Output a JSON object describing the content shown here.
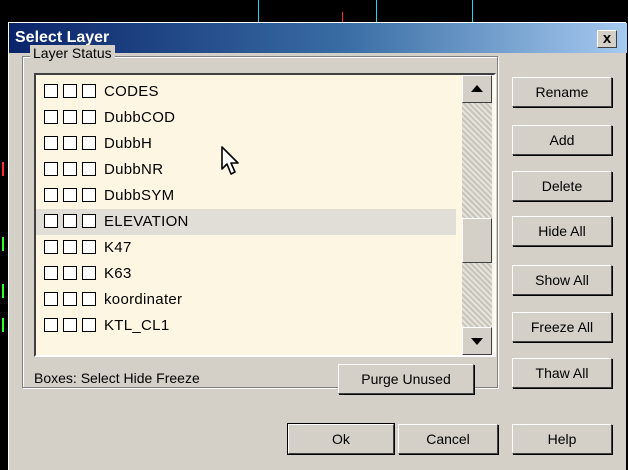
{
  "window": {
    "title": "Select Layer",
    "close_label": "x"
  },
  "group": {
    "label": "Layer Status"
  },
  "layers": [
    {
      "name": "CODES"
    },
    {
      "name": "DubbCOD"
    },
    {
      "name": "DubbH"
    },
    {
      "name": "DubbNR"
    },
    {
      "name": "DubbSYM"
    },
    {
      "name": "ELEVATION"
    },
    {
      "name": "K47"
    },
    {
      "name": "K63"
    },
    {
      "name": "koordinater"
    },
    {
      "name": "KTL_CL1"
    }
  ],
  "footer": {
    "hint": "Boxes: Select Hide Freeze",
    "purge_label": "Purge Unused"
  },
  "side_buttons": {
    "rename": "Rename",
    "add": "Add",
    "delete": "Delete",
    "hide_all": "Hide All",
    "show_all": "Show All",
    "freeze_all": "Freeze All",
    "thaw_all": "Thaw All"
  },
  "bottom_buttons": {
    "ok": "Ok",
    "cancel": "Cancel",
    "help": "Help"
  },
  "colors": {
    "titlebar": "#0a246a",
    "list_background": "#fdf6e3",
    "dialog_face": "#d4d0c8"
  }
}
